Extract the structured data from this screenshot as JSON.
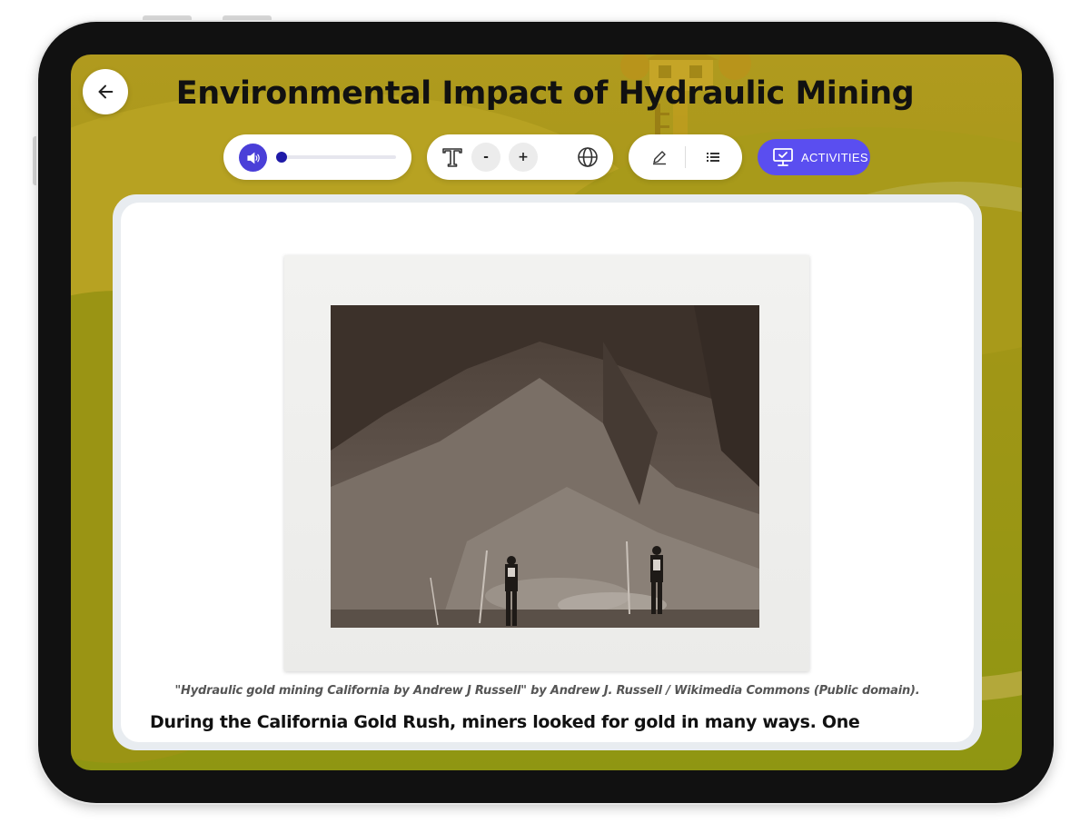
{
  "header": {
    "title": "Environmental Impact of Hydraulic Mining",
    "back_icon": "arrow-left-icon"
  },
  "toolbar": {
    "audio": {
      "icon": "speaker-icon",
      "progress": 0.03,
      "accent_color": "#4a3fd8"
    },
    "text_controls": {
      "font_icon": "text-size-icon",
      "decrease_label": "-",
      "increase_label": "+",
      "language_icon": "globe-icon"
    },
    "tools": {
      "annotate_icon": "pencil-icon",
      "list_icon": "list-icon"
    },
    "activities": {
      "label": "ACTIVITIES",
      "icon": "monitor-check-icon",
      "color": "#5a4ef0"
    }
  },
  "content": {
    "image_caption": "\"Hydraulic gold mining California by Andrew J Russell\" by Andrew J. Russell / Wikimedia Commons (Public domain).",
    "body_text": "During the California Gold Rush, miners looked for gold in many ways. One"
  }
}
